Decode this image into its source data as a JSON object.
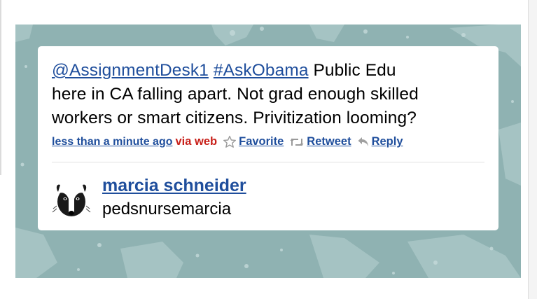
{
  "tweet": {
    "mention": "@AssignmentDesk1",
    "hashtag": "#AskObama",
    "text_line1_rest": " Public Edu",
    "text_line2": "here in CA falling apart. Not grad enough skilled",
    "text_line3": "workers or smart citizens. Privitization looming?",
    "timestamp": "less than a minute ago",
    "via": "via web",
    "actions": {
      "favorite": "Favorite",
      "retweet": "Retweet",
      "reply": "Reply"
    },
    "author": {
      "name": "marcia schneider",
      "handle": "pedsnursemarcia"
    }
  },
  "icons": [
    "star-icon",
    "retweet-icon",
    "reply-icon",
    "badger-avatar"
  ],
  "colors": {
    "link": "#1f4e9c",
    "via": "#c8201a",
    "background": "#8fb2b2",
    "card": "#ffffff"
  }
}
